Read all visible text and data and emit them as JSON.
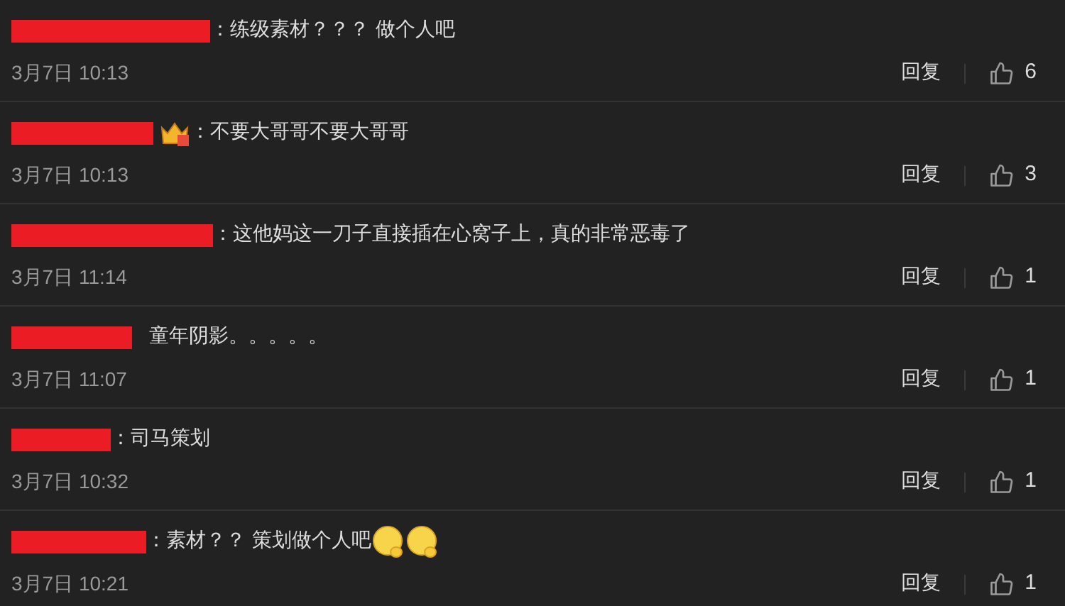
{
  "comments": [
    {
      "text": "：练级素材？？？ 做个人吧",
      "time": "3月7日 10:13",
      "reply": "回复",
      "likes": "6"
    },
    {
      "text": "：不要大哥哥不要大哥哥",
      "badge": {
        "kind": "crown"
      },
      "time": "3月7日 10:13",
      "reply": "回复",
      "likes": "3"
    },
    {
      "text": "：这他妈这一刀子直接插在心窝子上，真的非常恶毒了",
      "time": "3月7日 11:14",
      "reply": "回复",
      "likes": "1"
    },
    {
      "text": "童年阴影。。。。。",
      "time": "3月7日 11:07",
      "reply": "回复",
      "likes": "1"
    },
    {
      "text": "：司马策划",
      "time": "3月7日 10:32",
      "reply": "回复",
      "likes": "1"
    },
    {
      "text": "：素材？？ 策划做个人吧",
      "emojis": [
        {
          "kind": "smile"
        },
        {
          "kind": "smile"
        }
      ],
      "time": "3月7日 10:21",
      "reply": "回复",
      "likes": "1"
    }
  ]
}
